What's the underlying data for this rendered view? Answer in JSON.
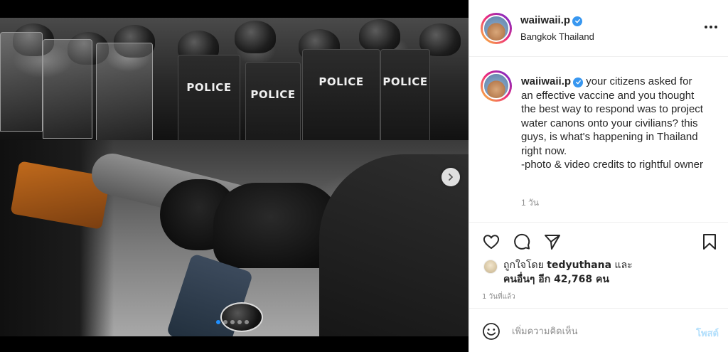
{
  "post": {
    "images": {
      "shield_labels": [
        "POLICE",
        "POLICE",
        "POLICE",
        "POLICE"
      ],
      "carousel_dot_count": 5,
      "carousel_active_index": 0
    }
  },
  "header": {
    "username": "waiiwaii.p",
    "location": "Bangkok Thailand",
    "verified": true
  },
  "caption": {
    "username": "waiiwaii.p",
    "text": "your citizens asked for an effective vaccine and you thought the best way to respond was to project water canons onto your civilians? this guys, is what's happening in Thailand right now.\n-photo & video credits to rightful owner",
    "time_ago": "1 วัน"
  },
  "actions": {
    "icons": [
      "heart-icon",
      "comment-icon",
      "share-icon",
      "bookmark-icon"
    ]
  },
  "likes": {
    "prefix": "ถูกใจโดย",
    "liker": "tedyuthana",
    "conjunction": "และ",
    "others": "คนอื่นๆ อีก 42,768 คน"
  },
  "posted": "1 วันที่แล้ว",
  "comment": {
    "placeholder": "เพิ่มความคิดเห็น",
    "post_label": "โพสต์"
  },
  "colors": {
    "verified": "#3897f0",
    "active_dot": "#1f8fff",
    "post_button_disabled": "#b2dffc"
  }
}
